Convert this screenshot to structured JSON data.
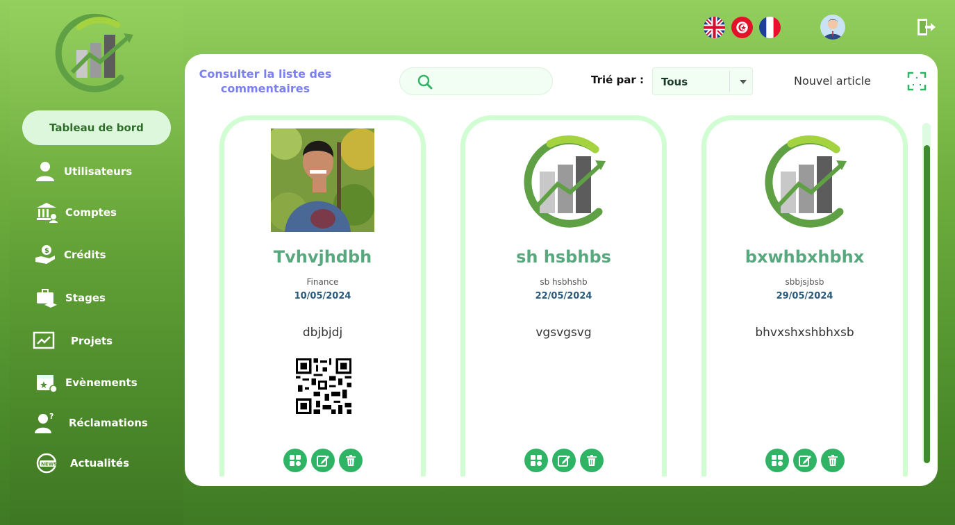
{
  "sidebar": {
    "active": "Tableau de bord",
    "items": [
      {
        "label": "Utilisateurs",
        "icon": "user-icon"
      },
      {
        "label": "Comptes",
        "icon": "bank-icon"
      },
      {
        "label": "Crédits",
        "icon": "money-hand-icon"
      },
      {
        "label": "Stages",
        "icon": "briefcase-icon"
      },
      {
        "label": "Projets",
        "icon": "chart-board-icon"
      },
      {
        "label": "Evènements",
        "icon": "calendar-icon"
      },
      {
        "label": "Réclamations",
        "icon": "question-user-icon"
      },
      {
        "label": "Actualités",
        "icon": "news-icon"
      }
    ]
  },
  "header": {
    "flags": [
      "uk-flag-icon",
      "tunisia-flag-icon",
      "france-flag-icon"
    ]
  },
  "toolbar": {
    "title": "Consulter la liste des commentaires",
    "search_placeholder": "",
    "sort_label": "Trié par :",
    "sort_value": "Tous",
    "new_article": "Nouvel article"
  },
  "cards": [
    {
      "title": "Tvhvjhdbh",
      "category": "Finance",
      "date": "10/05/2024",
      "description": "dbjbjdj",
      "image": "person-photo",
      "has_qr": true
    },
    {
      "title": "sh hsbhbs",
      "category": "sb hsbhshb",
      "date": "22/05/2024",
      "description": "vgsvgsvg",
      "image": "logo-image",
      "has_qr": false
    },
    {
      "title": "bxwhbxhbhx",
      "category": "sbbjsjbsb",
      "date": "29/05/2024",
      "description": "bhvxshxshbhxsb",
      "image": "logo-image",
      "has_qr": false
    }
  ],
  "colors": {
    "accent_green": "#2fb465",
    "title_green": "#58a87e",
    "card_border": "#d1fdd3",
    "header_link": "#7b7ff0"
  }
}
